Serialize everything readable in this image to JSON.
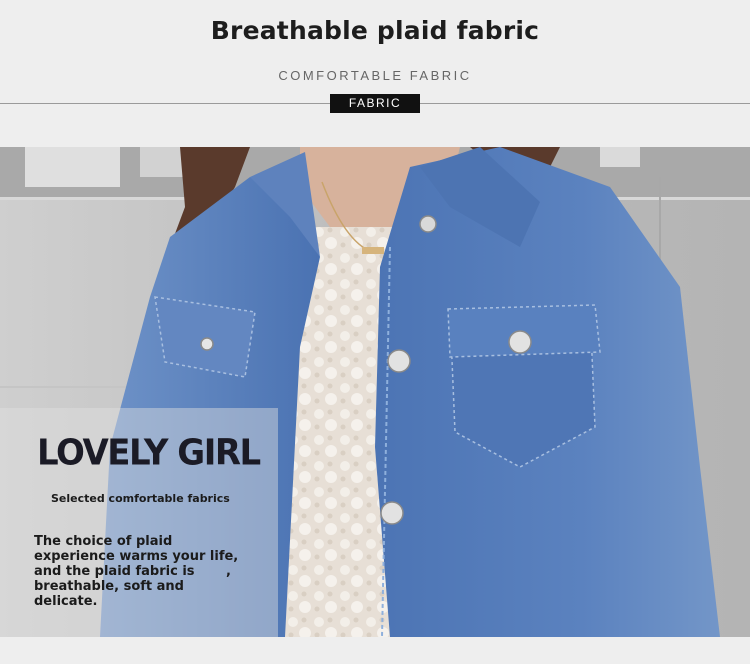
{
  "header": {
    "title": "Breathable plaid fabric",
    "subtitle": "COMFORTABLE FABRIC",
    "tag": "FABRIC"
  },
  "photo": {
    "description_icon": "denim-jacket-photo"
  },
  "overlay": {
    "headline": "LOVELY GIRL",
    "tagline": "Selected comfortable fabrics",
    "paragraph_lines": [
      "The choice of plaid",
      "experience warms your life,",
      "and the plaid fabric is",
      "breathable, soft and",
      "delicate."
    ],
    "stray_comma": ","
  },
  "colors": {
    "background": "#eeeeee",
    "tag_background": "#111111",
    "denim": "#4f78b8"
  }
}
